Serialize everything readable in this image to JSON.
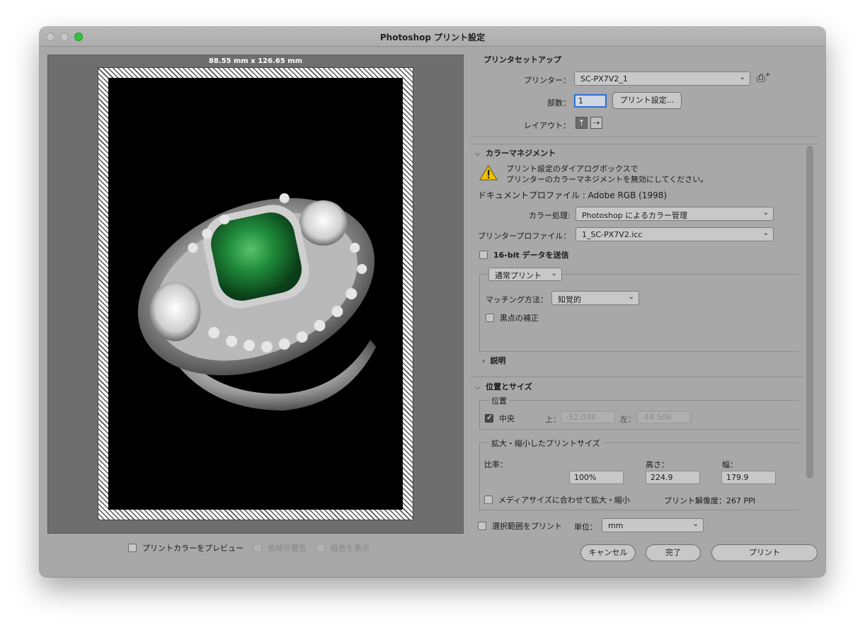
{
  "window": {
    "title": "Photoshop プリント設定"
  },
  "preview": {
    "dimensions": "88.55 mm x 126.65 mm",
    "options": [
      {
        "label": "プリントカラーをプレビュー",
        "disabled": false
      },
      {
        "label": "色域外警告",
        "disabled": true
      },
      {
        "label": "紙色を表示",
        "disabled": true
      }
    ]
  },
  "printer_setup": {
    "title": "プリンタセットアップ",
    "printer_label": "プリンター：",
    "printer_value": "SC-PX7V2_1",
    "copies_label": "部数：",
    "copies_value": "1",
    "print_settings_button": "プリント設定...",
    "layout_label": "レイアウト："
  },
  "color_management": {
    "title": "カラーマネジメント",
    "warning_line1": "プリント設定のダイアログボックスで",
    "warning_line2": "プリンターのカラーマネジメントを無効にしてください。",
    "document_profile": "ドキュメントプロファイル : Adobe RGB (1998)",
    "color_handling_label": "カラー処理:",
    "color_handling_value": "Photoshop によるカラー管理",
    "printer_profile_label": "プリンタープロファイル：",
    "printer_profile_value": "1_SC-PX7V2.icc",
    "send_16bit": "16-bit データを送信",
    "normal_print": "通常プリント",
    "matching_label": "マッチング方法：",
    "matching_value": "知覚的",
    "black_point": "黒点の補正",
    "description": "説明"
  },
  "position_size": {
    "title": "位置とサイズ",
    "position_legend": "位置",
    "center": "中央",
    "top_label": "上：",
    "top_value": "-52.034",
    "left_label": "左：",
    "left_value": "-48.506",
    "scaled_legend": "拡大・縮小したプリントサイズ",
    "scale_label": "比率：",
    "height_label": "高さ：",
    "width_label": "幅：",
    "scale_value": "100%",
    "height_value": "224.9",
    "width_value": "179.9",
    "fit_media": "メディアサイズに合わせて拡大・縮小",
    "resolution": "プリント解像度：267 PPI",
    "print_selection": "選択範囲をプリント",
    "unit_label": "単位：",
    "unit_value": "mm"
  },
  "buttons": {
    "cancel": "キャンセル",
    "done": "完了",
    "print": "プリント"
  },
  "colors": {
    "accent": "#2d6fd6",
    "warning": "#f2c200",
    "emerald": "#1f8a3a"
  }
}
